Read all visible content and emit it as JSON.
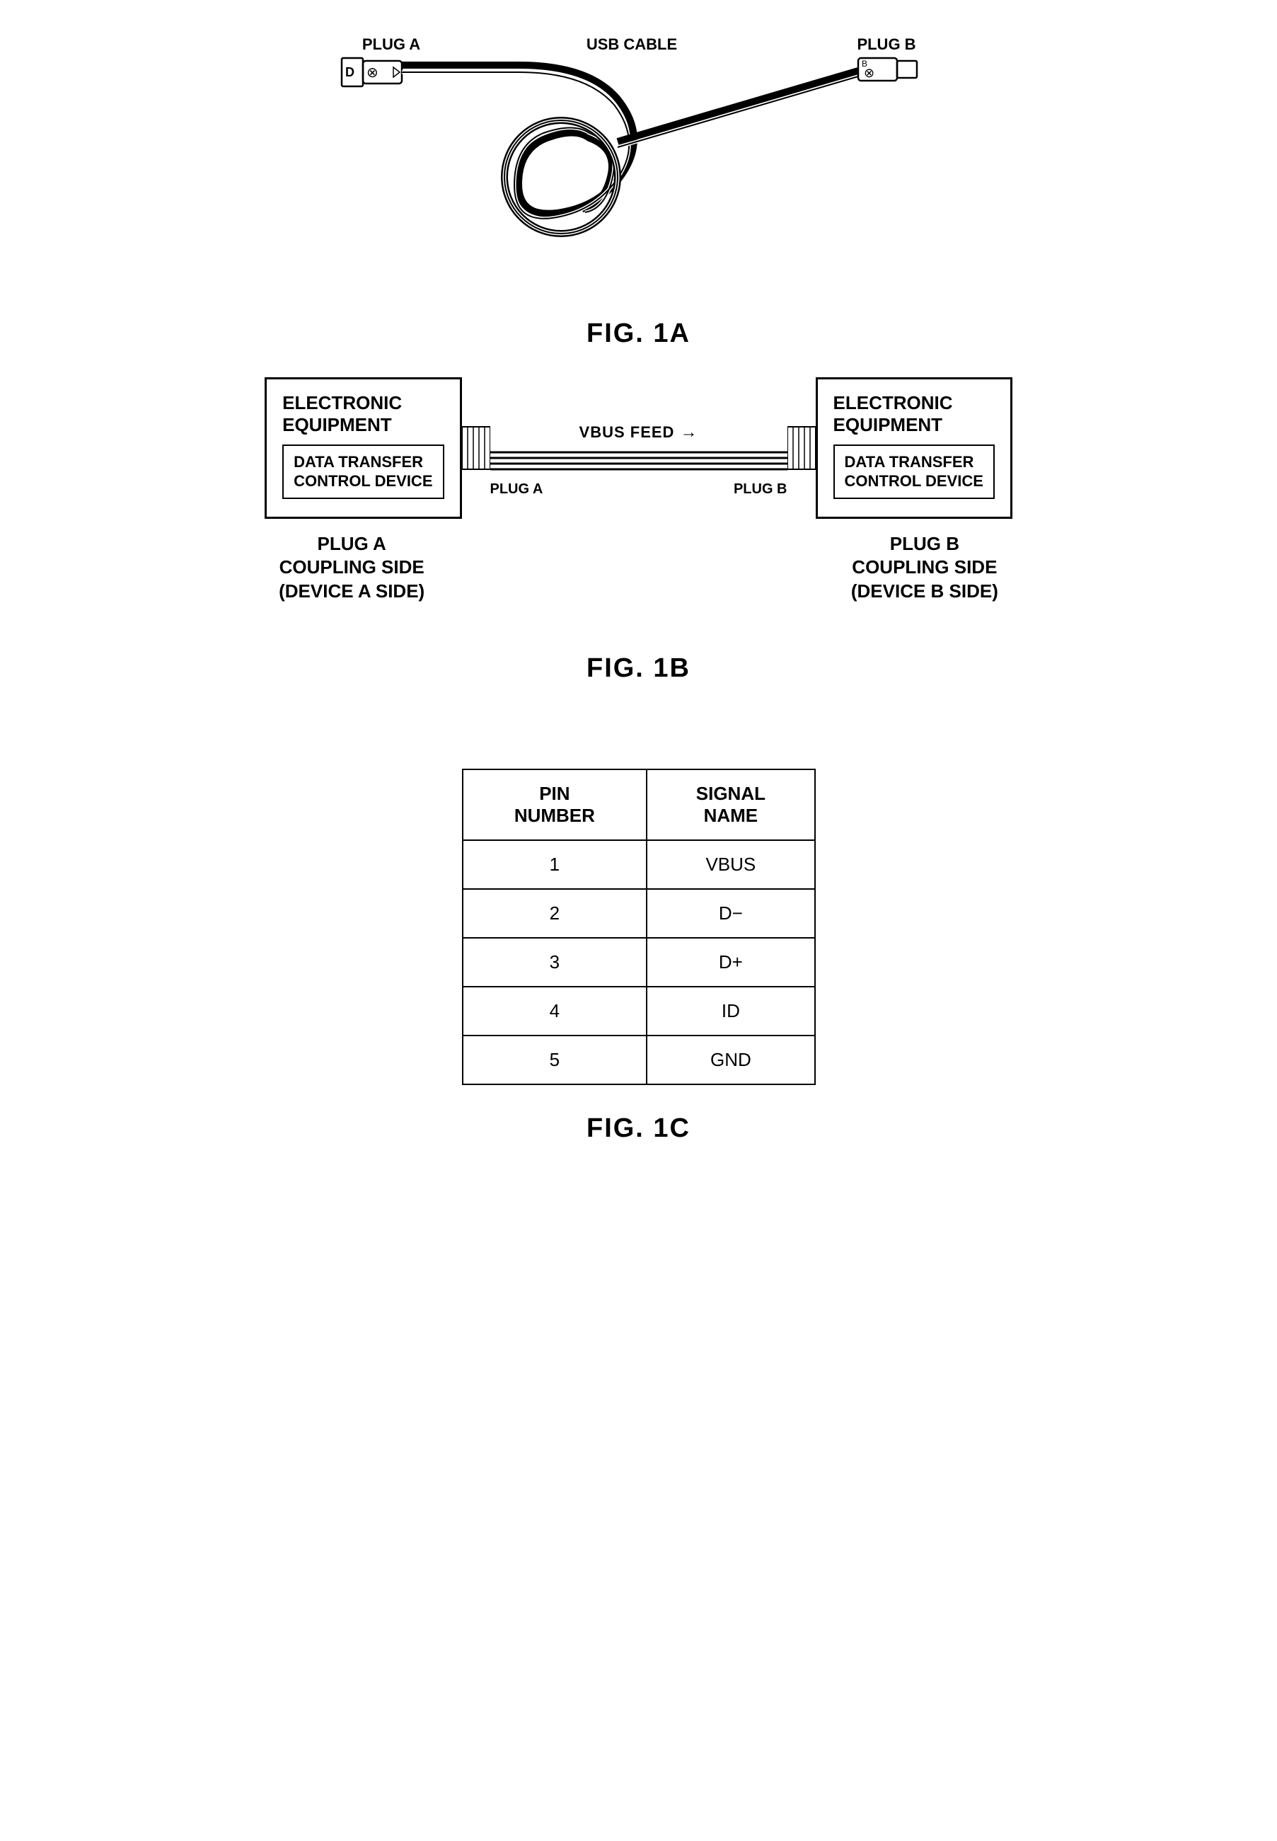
{
  "fig1a": {
    "label": "FIG. 1A",
    "plug_a_label": "PLUG A",
    "plug_b_label": "PLUG B",
    "usb_cable_label": "USB CABLE"
  },
  "fig1b": {
    "label": "FIG. 1B",
    "left_equipment_title": "ELECTRONIC\nEQUIPMENT",
    "right_equipment_title": "ELECTRONIC\nEQUIPMENT",
    "left_data_transfer": "DATA TRANSFER\nCONTROL DEVICE",
    "right_data_transfer": "DATA TRANSFER\nCONTROL DEVICE",
    "vbus_feed_label": "VBUS FEED",
    "plug_a_label": "PLUG A",
    "plug_b_label": "PLUG B",
    "left_side_label": "PLUG A\nCOUPLING SIDE\n(DEVICE A SIDE)",
    "right_side_label": "PLUG B\nCOUPLING SIDE\n(DEVICE B SIDE)"
  },
  "fig1c": {
    "label": "FIG. 1C",
    "col1_header": "PIN\nNUMBER",
    "col2_header": "SIGNAL\nNAME",
    "rows": [
      {
        "pin": "1",
        "signal": "VBUS"
      },
      {
        "pin": "2",
        "signal": "D−"
      },
      {
        "pin": "3",
        "signal": "D+"
      },
      {
        "pin": "4",
        "signal": "ID"
      },
      {
        "pin": "5",
        "signal": "GND"
      }
    ]
  }
}
